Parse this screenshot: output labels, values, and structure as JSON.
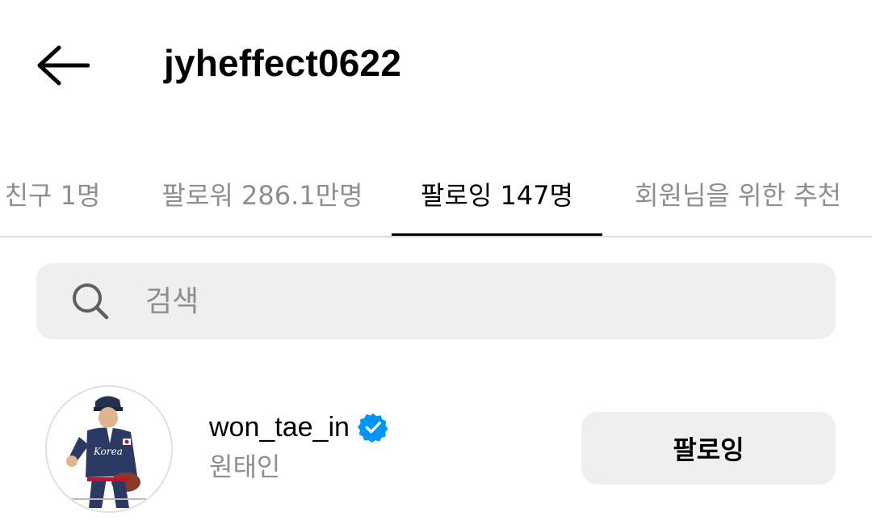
{
  "header": {
    "back_icon": "arrow-left-icon",
    "title": "jyheffect0622"
  },
  "tabs": [
    {
      "label": "친구 1명",
      "active": false
    },
    {
      "label": "팔로워 286.1만명",
      "active": false
    },
    {
      "label": "팔로잉 147명",
      "active": true
    },
    {
      "label": "회원님을 위한 추천",
      "active": false
    }
  ],
  "search": {
    "icon": "search-icon",
    "placeholder": "검색",
    "value": ""
  },
  "following_list": [
    {
      "username": "won_tae_in",
      "verified": true,
      "full_name": "원태인",
      "button_label": "팔로잉",
      "avatar": "baseball-player-avatar",
      "avatar_jersey_text": "Korea"
    }
  ],
  "colors": {
    "text_primary": "#000000",
    "text_secondary": "#8e8e8e",
    "surface": "#efefef",
    "divider": "#dbdbdb",
    "verified_blue": "#0095f6"
  }
}
